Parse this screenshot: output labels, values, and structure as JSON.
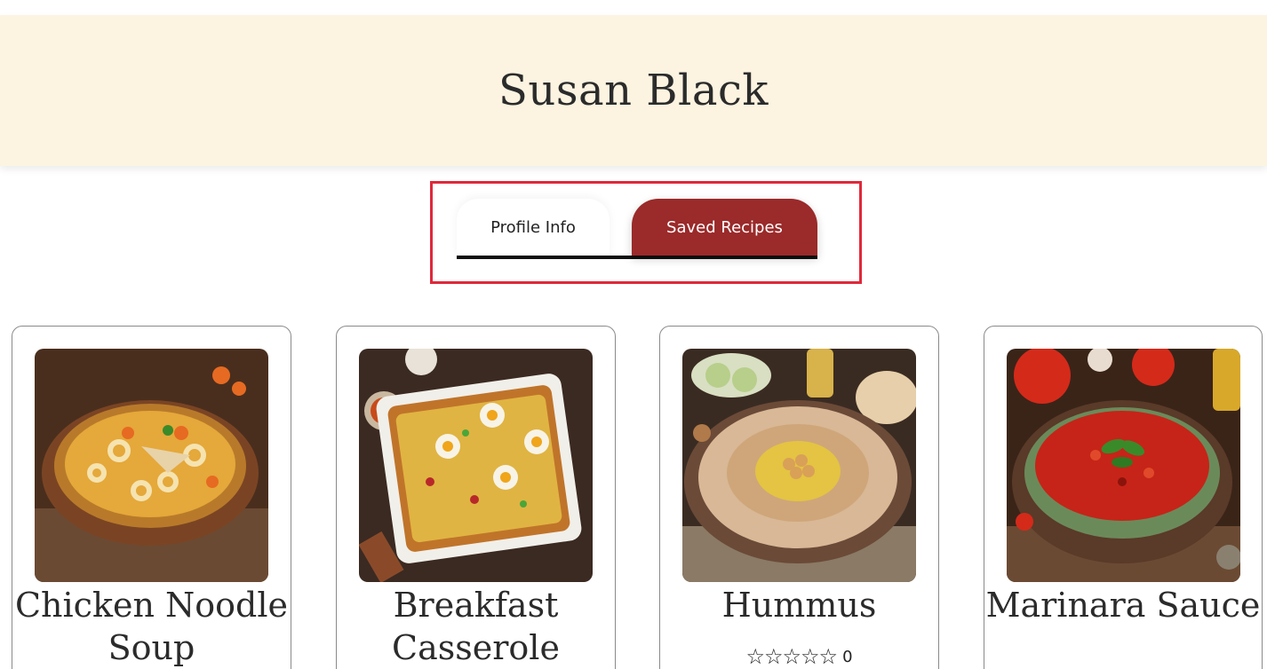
{
  "profile": {
    "name": "Susan Black"
  },
  "tabs": [
    {
      "label": "Profile Info",
      "active": false
    },
    {
      "label": "Saved Recipes",
      "active": true
    }
  ],
  "recipes": [
    {
      "title": "Chicken Noodle Soup",
      "image": "chicken-noodle-soup-photo"
    },
    {
      "title": "Breakfast Casserole",
      "image": "breakfast-casserole-photo"
    },
    {
      "title": "Hummus",
      "image": "hummus-photo",
      "stars": "☆☆☆☆☆",
      "rating_count": "0"
    },
    {
      "title": "Marinara Sauce",
      "image": "marinara-sauce-photo"
    }
  ],
  "colors": {
    "header_bg": "#fdf3e1",
    "accent": "#9b2a2a",
    "highlight_border": "#e0283a"
  }
}
